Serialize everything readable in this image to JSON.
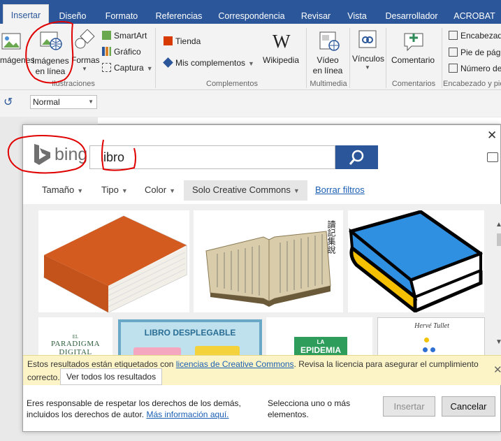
{
  "ribbon": {
    "tabs": [
      {
        "label": "Insertar",
        "active": true
      },
      {
        "label": "Diseño"
      },
      {
        "label": "Formato"
      },
      {
        "label": "Referencias"
      },
      {
        "label": "Correspondencia"
      },
      {
        "label": "Revisar"
      },
      {
        "label": "Vista"
      },
      {
        "label": "Desarrollador"
      },
      {
        "label": "ACROBAT"
      }
    ],
    "illustrations": {
      "imagenes": "mágenes",
      "imagenes_linea_1": "Imágenes",
      "imagenes_linea_2": "en línea",
      "formas": "Formas",
      "smartart": "SmartArt",
      "grafico": "Gráfico",
      "captura": "Captura",
      "group_label": "Ilustraciones"
    },
    "addins": {
      "tienda": "Tienda",
      "mis_complementos": "Mis complementos",
      "wikipedia": "Wikipedia",
      "group_label": "Complementos"
    },
    "media": {
      "video_1": "Vídeo",
      "video_2": "en línea",
      "group_label": "Multimedia"
    },
    "links": {
      "vinculos": "Vínculos"
    },
    "comments": {
      "comentario": "Comentario",
      "group_label": "Comentarios"
    },
    "header_footer": {
      "encabezado": "Encabezado",
      "pie": "Pie de página",
      "numero": "Número de",
      "group_label": "Encabezado y pie"
    }
  },
  "toolbar": {
    "style": "Normal"
  },
  "dialog": {
    "brand": "bing",
    "search_value": "libro",
    "filters": [
      {
        "label": "Tamaño"
      },
      {
        "label": "Tipo"
      },
      {
        "label": "Color"
      },
      {
        "label": "Solo Creative Commons",
        "active": true
      }
    ],
    "clear_filters": "Borrar filtros",
    "results": [
      {
        "kind": "book-orange"
      },
      {
        "kind": "book-antique",
        "label": "讀記集說"
      },
      {
        "kind": "book-blue-cartoon"
      },
      {
        "kind": "cover-paradigma",
        "label_1": "EL",
        "label_2": "PARADIGMA",
        "label_3": "DIGITAL"
      },
      {
        "kind": "libro-desplegable",
        "label": "LIBRO DESPLEGABLE"
      },
      {
        "kind": "cover-epidemia",
        "label_1": "LA",
        "label_2": "EPIDEMIA"
      },
      {
        "kind": "cover-herve-tullet",
        "label": "Hervé Tullet"
      }
    ],
    "notice": {
      "text_before": "Estos resultados están etiquetados con ",
      "link": "licencias de Creative Commons",
      "text_after": ". Revisa la licencia para asegurar el cumplimiento",
      "line2": "correcto.",
      "button": "Ver todos los resultados"
    },
    "footer": {
      "responsibility_1": "Eres responsable de respetar los derechos de los demás,",
      "responsibility_2": "incluidos los derechos de autor. ",
      "more_info": "Más información aquí.",
      "select_hint": "Selecciona uno o más elementos."
    },
    "buttons": {
      "insert": "Insertar",
      "cancel": "Cancelar"
    }
  },
  "colors": {
    "ribbon_blue": "#2b579a",
    "notice_yellow": "#fcf4c6",
    "annotation_red": "#e00000"
  }
}
